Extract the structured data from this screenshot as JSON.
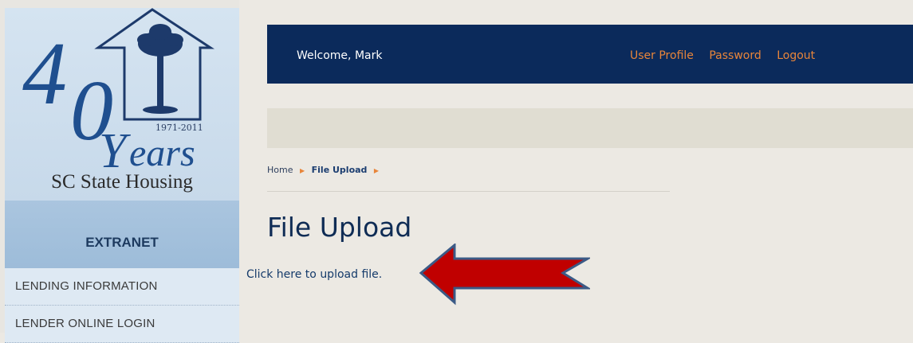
{
  "logo": {
    "years_number": "40",
    "years_word": "ears",
    "dates": "1971-2011",
    "org_name": "SC State Housing"
  },
  "sidebar": {
    "heading": "EXTRANET",
    "items": [
      {
        "label": "LENDING INFORMATION"
      },
      {
        "label": "LENDER ONLINE LOGIN"
      }
    ]
  },
  "header": {
    "welcome": "Welcome, Mark",
    "links": [
      {
        "label": "User Profile"
      },
      {
        "label": "Password"
      },
      {
        "label": "Logout"
      }
    ]
  },
  "breadcrumb": {
    "home": "Home",
    "current": "File Upload"
  },
  "main": {
    "title": "File Upload",
    "upload_link": "Click here to upload file."
  },
  "colors": {
    "nav_bar": "#0b2a5b",
    "link_orange": "#e8853a",
    "arrow_red": "#c00000",
    "arrow_outline": "#3b5a86"
  },
  "annotation": {
    "arrow_icon": "left-arrow-icon"
  }
}
